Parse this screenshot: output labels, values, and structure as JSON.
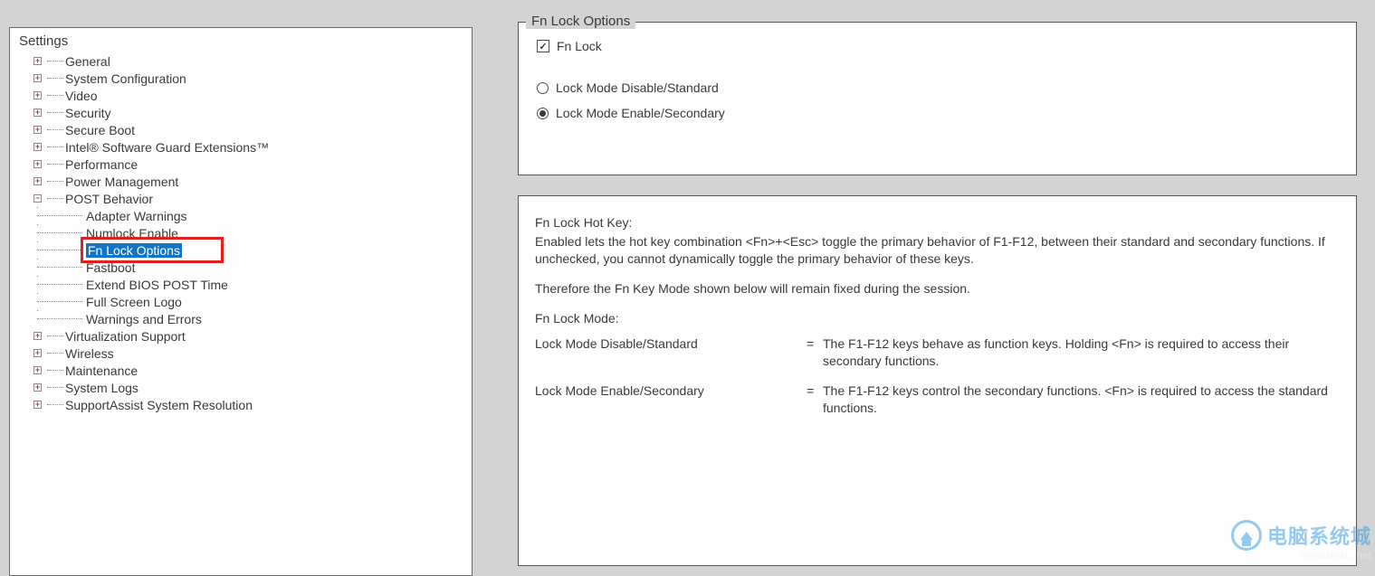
{
  "tree": {
    "root_label": "Settings",
    "items": [
      {
        "label": "General",
        "expandable": true
      },
      {
        "label": "System Configuration",
        "expandable": true
      },
      {
        "label": "Video",
        "expandable": true
      },
      {
        "label": "Security",
        "expandable": true
      },
      {
        "label": "Secure Boot",
        "expandable": true
      },
      {
        "label": "Intel® Software Guard Extensions™",
        "expandable": true
      },
      {
        "label": "Performance",
        "expandable": true
      },
      {
        "label": "Power Management",
        "expandable": true
      },
      {
        "label": "POST Behavior",
        "expandable": true,
        "expanded": true,
        "children": [
          {
            "label": "Adapter Warnings"
          },
          {
            "label": "Numlock Enable"
          },
          {
            "label": "Fn Lock Options",
            "selected": true,
            "highlighted": true
          },
          {
            "label": "Fastboot"
          },
          {
            "label": "Extend BIOS POST Time"
          },
          {
            "label": "Full Screen Logo"
          },
          {
            "label": "Warnings and Errors"
          }
        ]
      },
      {
        "label": "Virtualization Support",
        "expandable": true
      },
      {
        "label": "Wireless",
        "expandable": true
      },
      {
        "label": "Maintenance",
        "expandable": true
      },
      {
        "label": "System Logs",
        "expandable": true
      },
      {
        "label": "SupportAssist System Resolution",
        "expandable": true
      }
    ]
  },
  "panel": {
    "title": "Fn Lock Options",
    "checkbox_label": "Fn Lock",
    "checkbox_checked": true,
    "radios": [
      {
        "label": "Lock Mode Disable/Standard",
        "checked": false
      },
      {
        "label": "Lock Mode Enable/Secondary",
        "checked": true
      }
    ],
    "desc": {
      "hotkey_title": "Fn Lock Hot Key:",
      "hotkey_para": "Enabled lets the hot key combination <Fn>+<Esc> toggle the primary behavior of F1-F12, between their standard and secondary functions. If unchecked, you cannot dynamically toggle the primary behavior of these keys.",
      "therefore": "Therefore the Fn Key Mode shown below will remain fixed during the session.",
      "mode_title": "Fn Lock Mode:",
      "rows": [
        {
          "label": "Lock Mode Disable/Standard",
          "eq": "=",
          "desc": "The F1-F12 keys behave as function keys. Holding <Fn> is required to access their secondary functions."
        },
        {
          "label": "Lock Mode Enable/Secondary",
          "eq": "=",
          "desc": "The F1-F12 keys control the secondary functions. <Fn> is required to access the standard functions."
        }
      ]
    }
  },
  "watermark": {
    "cn": "电脑系统城",
    "en": "www.dnxtc.net"
  }
}
